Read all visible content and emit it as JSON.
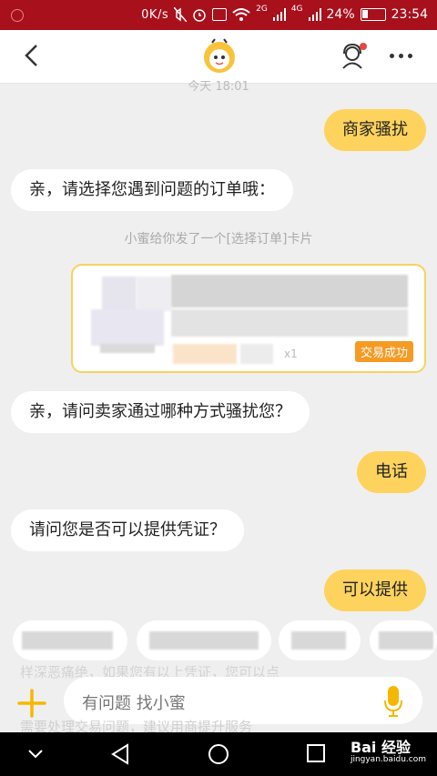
{
  "status_bar": {
    "network_speed": "0K/s",
    "signal_2g": "2G",
    "signal_4g": "4G",
    "battery_percent": "24%",
    "time": "23:54"
  },
  "header": {
    "back_icon": "chevron-left-icon",
    "avatar_icon": "bee-mascot-icon",
    "agent_icon": "customer-service-icon",
    "more_icon": "more-horizontal-icon"
  },
  "chat": {
    "timestamp": "今天 18:01",
    "messages": [
      {
        "side": "right",
        "text": "商家骚扰"
      },
      {
        "side": "left",
        "text": "亲，请选择您遇到问题的订单哦："
      },
      {
        "side": "system",
        "text": "小蜜给你发了一个[选择订单]卡片"
      },
      {
        "side": "left",
        "text": "亲，请问卖家通过哪种方式骚扰您？"
      },
      {
        "side": "right",
        "text": "电话"
      },
      {
        "side": "left",
        "text": "请问您是否可以提供凭证？"
      },
      {
        "side": "right",
        "text": "可以提供"
      }
    ],
    "order_card": {
      "quantity": "x1",
      "status_badge": "交易成功"
    },
    "ghost_text_1": "样深恶痛绝，如果您有以上凭证，您可以点",
    "ghost_text_2": "需要处理交易问题，建议用商提升服务"
  },
  "input_bar": {
    "placeholder": "有问题 找小蜜",
    "plus_icon": "plus-icon",
    "mic_icon": "microphone-icon"
  },
  "nav_bar": {
    "icons": [
      "chevron-down-icon",
      "back-triangle-icon",
      "home-circle-icon",
      "recents-square-icon"
    ]
  },
  "watermark": {
    "text": "Bai 经验",
    "url": "jingyan.baidu.com"
  },
  "colors": {
    "status_bar": "#a8101c",
    "user_bubble": "#fdd35d",
    "accent": "#f5b800",
    "badge": "#f59a23"
  }
}
